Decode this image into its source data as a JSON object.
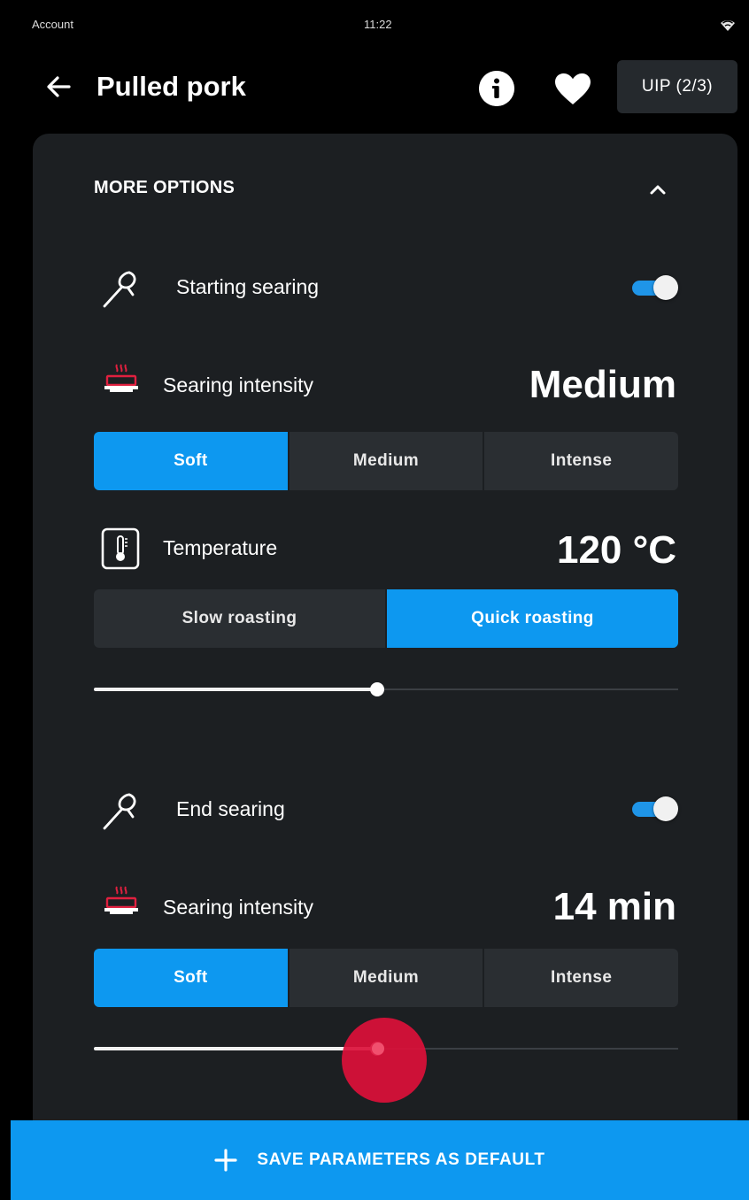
{
  "status_bar": {
    "left_label": "Account",
    "time": "11:22",
    "wifi_icon": "wifi-icon"
  },
  "header": {
    "title": "Pulled pork",
    "uip_label": "UIP (2/3)",
    "icons": [
      "back-arrow-icon",
      "info-icon",
      "heart-icon"
    ]
  },
  "more_options": {
    "title": "MORE OPTIONS",
    "expanded": true
  },
  "starting_searing": {
    "label": "Starting searing",
    "enabled": true,
    "intensity": {
      "label": "Searing intensity",
      "value": "Medium",
      "options": [
        "Soft",
        "Medium",
        "Intense"
      ],
      "selected": "Soft"
    },
    "temperature": {
      "label": "Temperature",
      "value": "120 °C",
      "options": [
        "Slow roasting",
        "Quick roasting"
      ],
      "selected": "Quick roasting",
      "slider_fraction": 0.485
    }
  },
  "end_searing": {
    "label": "End searing",
    "enabled": true,
    "intensity": {
      "label": "Searing intensity",
      "value": "14 min",
      "options": [
        "Soft",
        "Medium",
        "Intense"
      ],
      "selected": "Soft",
      "slider_fraction": 0.485
    }
  },
  "save_button": {
    "label": "SAVE PARAMETERS AS DEFAULT"
  },
  "colors": {
    "accent": "#0d98f0",
    "card": "#1c1f22",
    "background": "#000000",
    "touch": "#dc103a"
  }
}
